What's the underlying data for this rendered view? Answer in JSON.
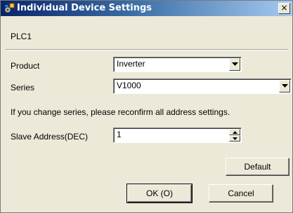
{
  "window": {
    "title": "Individual Device Settings",
    "close_glyph": "×"
  },
  "header": {
    "device_name": "PLC1"
  },
  "form": {
    "product_label": "Product",
    "product_value": "Inverter",
    "series_label": "Series",
    "series_value": "V1000",
    "notice": "If you change series, please reconfirm all address settings.",
    "slave_label": "Slave Address(DEC)",
    "slave_value": "1"
  },
  "buttons": {
    "default": "Default",
    "ok": "OK (O)",
    "cancel": "Cancel"
  },
  "icons": {
    "title": "device-settings-icon",
    "dropdown": "chevron-down-icon",
    "spin_up": "spin-up-icon",
    "spin_down": "spin-down-icon"
  },
  "colors": {
    "titlebar_start": "#0a246a",
    "titlebar_end": "#a6caf0",
    "dialog_bg": "#ece9d8"
  }
}
